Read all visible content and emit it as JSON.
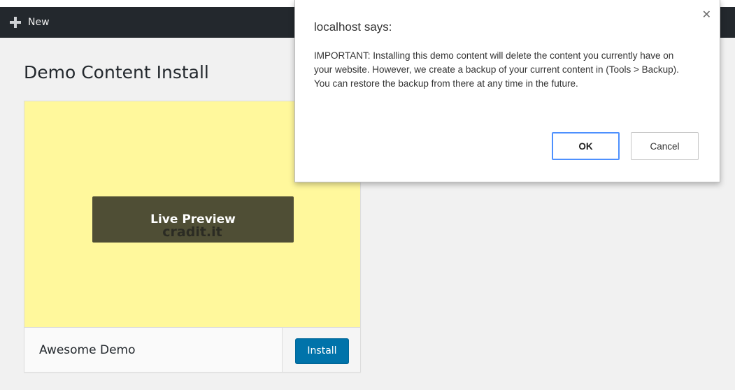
{
  "admin_bar": {
    "new_label": "New",
    "new_icon": "plus-icon"
  },
  "page": {
    "title": "Demo Content Install"
  },
  "theme_card": {
    "screenshot_text": "cradit.it",
    "live_preview_label": "Live Preview",
    "name": "Awesome Demo",
    "install_label": "Install"
  },
  "dialog": {
    "title": "localhost says:",
    "message": "IMPORTANT: Installing this demo content will delete the content you currently have on your website. However, we create a backup of your current content in (Tools > Backup). You can restore the backup from there at any time in the future.",
    "ok_label": "OK",
    "cancel_label": "Cancel",
    "close_icon": "close-icon"
  },
  "colors": {
    "admin_bar": "#23282d",
    "screenshot_bg": "#fff89c",
    "install_button": "#0073aa",
    "ok_border": "#4d90fe"
  }
}
